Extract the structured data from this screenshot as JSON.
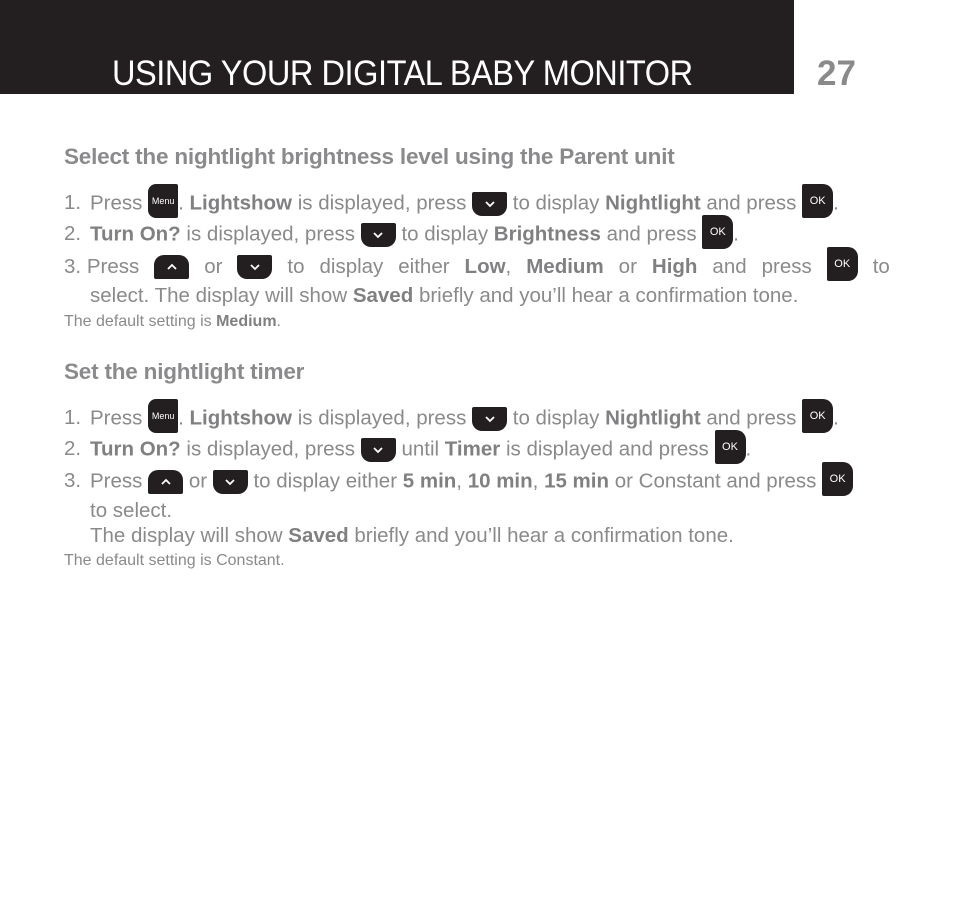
{
  "header": {
    "title": "USING YOUR DIGITAL BABY MONITOR",
    "page_number": "27"
  },
  "icons": {
    "menu_key": "Menu",
    "ok_key": "OK",
    "down_key": "down-arrow",
    "up_key": "up-arrow"
  },
  "section1": {
    "heading": "Select the nightlight brightness level using the Parent unit",
    "steps": [
      {
        "num": "1.",
        "t1": "Press",
        "t2": ".",
        "b1": "Lightshow",
        "t3": "is displayed, press",
        "t4": "to display",
        "b2": "Nightlight",
        "t5": "and press",
        "t6": "."
      },
      {
        "num": "2.",
        "b1": "Turn On?",
        "t1": "is displayed, press",
        "t2": "to display",
        "b2": "Brightness",
        "t3": "and press",
        "t4": "."
      },
      {
        "num": "3.",
        "t1": "Press",
        "t2": "or",
        "t3": "to",
        "t4": "display",
        "t5": "either",
        "b1": "Low",
        "c1": ",",
        "b2": "Medium",
        "t6": "or",
        "b3": "High",
        "t7": "and",
        "t8": "press",
        "t9": "to",
        "line2a": "select. The display will show",
        "b4": "Saved",
        "line2b": "briefly and you’ll hear a confirmation tone."
      }
    ],
    "note_prefix": "The default setting is",
    "note_bold": "Medium",
    "note_suffix": "."
  },
  "section2": {
    "heading": "Set the nightlight timer",
    "steps": [
      {
        "num": "1.",
        "t1": "Press",
        "t2": ".",
        "b1": "Lightshow",
        "t3": "is displayed, press",
        "t4": "to display",
        "b2": "Nightlight",
        "t5": "and press",
        "t6": "."
      },
      {
        "num": "2.",
        "b1": "Turn On?",
        "t1": "is displayed, press",
        "t2": "until",
        "b2": "Timer",
        "t3": "is displayed and press",
        "t4": "."
      },
      {
        "num": "3.",
        "t1": "Press",
        "t2": "or",
        "t3": "to display either",
        "b1": "5 min",
        "c1": ",",
        "b2": "10 min",
        "c2": ",",
        "b3": "15 min",
        "t4": "or Constant and press",
        "line2": "to select.",
        "line3a": "The display will show",
        "b4": "Saved",
        "line3b": "briefly and you’ll hear a confirmation tone."
      }
    ],
    "note": "The default setting is Constant."
  }
}
